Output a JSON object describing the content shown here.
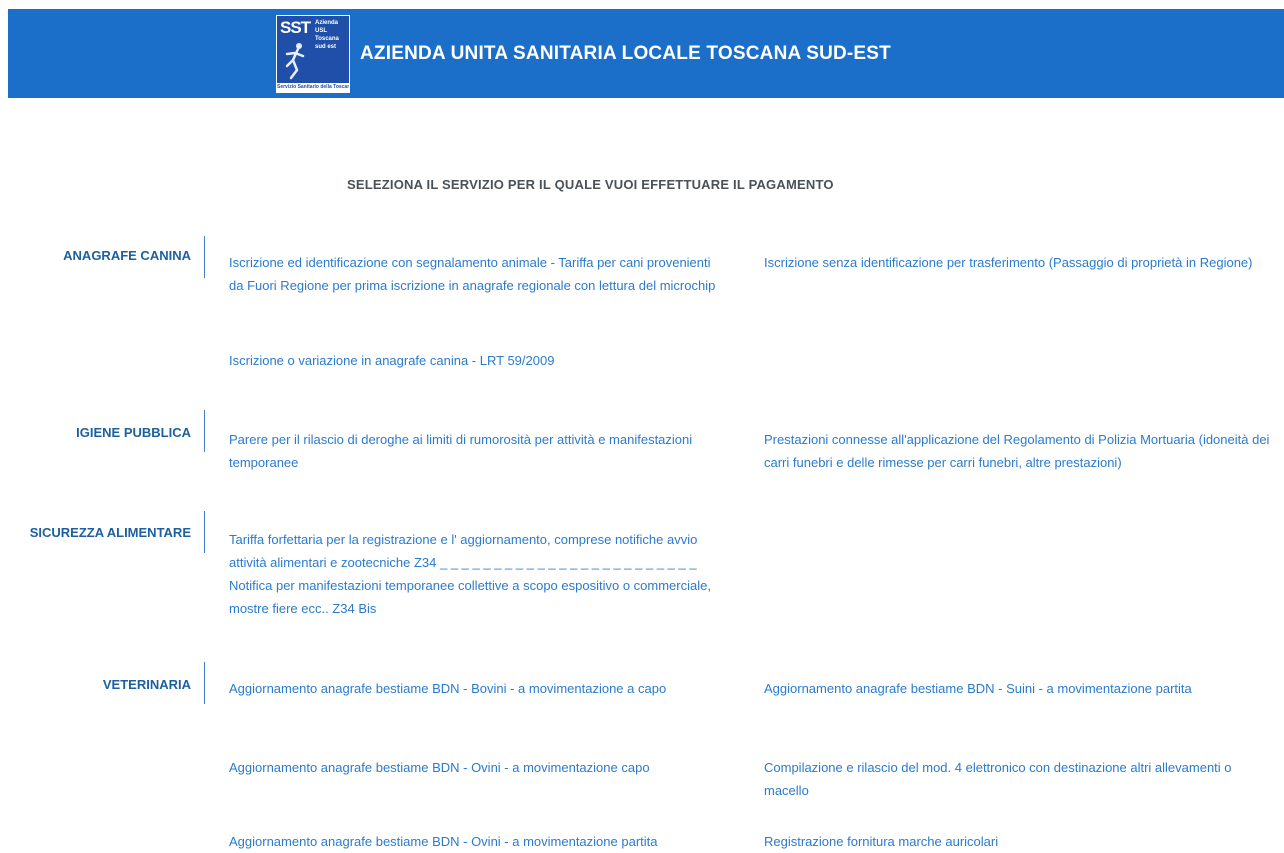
{
  "header": {
    "logo": {
      "big_text": "SST",
      "small_text": "Azienda USL Toscana sud est",
      "footer_text": "Servizio Sanitario della Toscana"
    },
    "title": "AZIENDA UNITA SANITARIA LOCALE TOSCANA SUD-EST",
    "background_color": "#1b6fc8"
  },
  "main": {
    "heading": "SELEZIONA IL SERVIZIO PER IL QUALE VUOI EFFETTUARE IL PAGAMENTO",
    "categories": [
      {
        "label": "ANAGRAFE CANINA",
        "services": [
          "Iscrizione ed identificazione con segnalamento animale - Tariffa per cani provenienti da Fuori Regione per prima iscrizione in anagrafe regionale con lettura del microchip",
          "Iscrizione senza identificazione per trasferimento (Passaggio di proprietà in Regione)",
          "Iscrizione o variazione in anagrafe canina - LRT 59/2009"
        ]
      },
      {
        "label": "IGIENE PUBBLICA",
        "services": [
          "Parere per il rilascio di deroghe ai limiti di rumorosità per attività e manifestazioni temporanee",
          "Prestazioni connesse all'applicazione del Regolamento di Polizia Mortuaria (idoneità dei carri funebri e delle rimesse per carri funebri, altre prestazioni)"
        ]
      },
      {
        "label": "SICUREZZA ALIMENTARE",
        "services": [
          "Tariffa forfettaria per la registrazione e l' aggiornamento, comprese notifiche avvio attività alimentari e zootecniche Z34 _ _ _ _ _ _ _ _ _ _ _ _ _ _ _ _ _ _ _ _ _ _ _ _ Notifica per manifestazioni temporanee collettive a scopo espositivo o commerciale, mostre fiere ecc.. Z34 Bis"
        ]
      },
      {
        "label": "VETERINARIA",
        "services": [
          "Aggiornamento anagrafe bestiame BDN - Bovini - a movimentazione a capo",
          "Aggiornamento anagrafe bestiame BDN - Suini - a movimentazione partita",
          "Aggiornamento anagrafe bestiame BDN - Ovini - a movimentazione capo",
          "Compilazione e rilascio del mod. 4 elettronico con destinazione altri allevamenti o macello",
          "Aggiornamento anagrafe bestiame BDN - Ovini - a movimentazione partita",
          "Registrazione fornitura marche auricolari"
        ]
      }
    ]
  },
  "colors": {
    "link": "#2b7bcc",
    "category": "#1d5f9f",
    "heading": "#4a5158"
  }
}
